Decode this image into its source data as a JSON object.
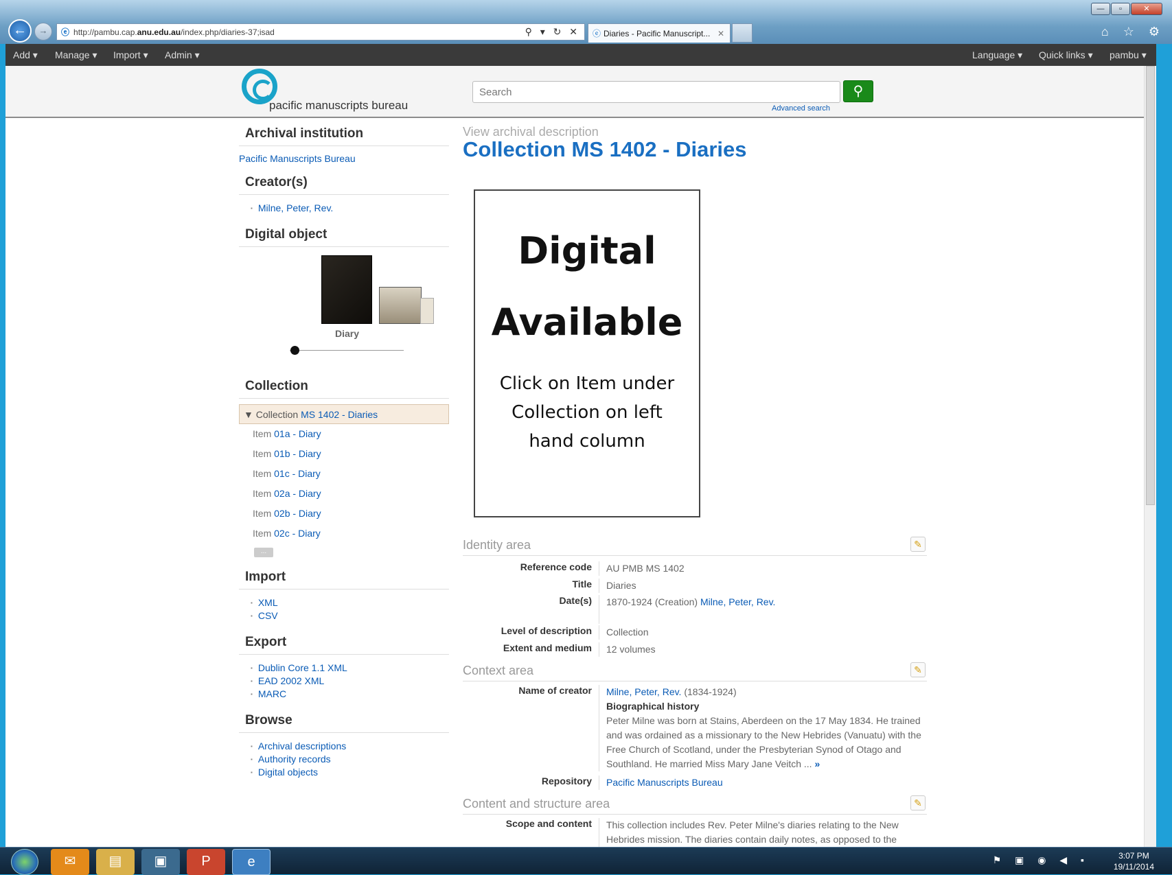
{
  "browser": {
    "url_prefix": "http://pambu.cap.",
    "url_domain": "anu.edu.au",
    "url_path": "/index.php/diaries-37;isad",
    "url_controls": "⚲ ▾ ↻ ✕",
    "tab_title": "Diaries - Pacific Manuscript...",
    "tab_close": "✕",
    "toolbar_icons": "⌂ ☆ ⚙"
  },
  "appbar": {
    "left": [
      "Add ▾",
      "Manage ▾",
      "Import ▾",
      "Admin ▾"
    ],
    "right": [
      "Language ▾",
      "Quick links ▾",
      "pambu ▾"
    ]
  },
  "header": {
    "logo_text": "pacific manuscripts bureau",
    "search_placeholder": "Search",
    "advanced_search": "Advanced search"
  },
  "sidebar": {
    "archival_institution": {
      "heading": "Archival institution",
      "link": "Pacific Manuscripts Bureau"
    },
    "creators": {
      "heading": "Creator(s)",
      "items": [
        "Milne, Peter, Rev."
      ]
    },
    "digital_object": {
      "heading": "Digital object",
      "caption": "Diary"
    },
    "collection": {
      "heading": "Collection",
      "root_prefix": "▼ Collection ",
      "root_link": "MS 1402 - Diaries",
      "items": [
        {
          "prefix": "Item ",
          "link": "01a - Diary"
        },
        {
          "prefix": "Item ",
          "link": "01b - Diary"
        },
        {
          "prefix": "Item ",
          "link": "01c - Diary"
        },
        {
          "prefix": "Item ",
          "link": "02a - Diary"
        },
        {
          "prefix": "Item ",
          "link": "02b - Diary"
        },
        {
          "prefix": "Item ",
          "link": "02c - Diary"
        }
      ],
      "more": "..."
    },
    "import": {
      "heading": "Import",
      "items": [
        "XML",
        "CSV"
      ]
    },
    "export": {
      "heading": "Export",
      "items": [
        "Dublin Core 1.1 XML",
        "EAD 2002 XML",
        "MARC"
      ]
    },
    "browse": {
      "heading": "Browse",
      "items": [
        "Archival descriptions",
        "Authority records",
        "Digital objects"
      ]
    }
  },
  "main": {
    "view_label": "View archival description",
    "title": "Collection MS 1402 - Diaries",
    "digital_placeholder": {
      "line1": "Digital",
      "line2": "Available",
      "line3": "Click on Item under",
      "line4": "Collection on left",
      "line5": "hand column"
    },
    "identity_area": {
      "heading": "Identity area",
      "reference_code_label": "Reference code",
      "reference_code": "AU PMB MS 1402",
      "title_label": "Title",
      "title": "Diaries",
      "dates_label": "Date(s)",
      "dates_text": "1870-1924 (Creation)",
      "dates_link": "Milne, Peter, Rev.",
      "level_label": "Level of description",
      "level": "Collection",
      "extent_label": "Extent and medium",
      "extent": "12 volumes"
    },
    "context_area": {
      "heading": "Context area",
      "creator_label": "Name of creator",
      "creator_link": "Milne, Peter, Rev.",
      "creator_dates": "(1834-1924)",
      "bio_heading": "Biographical history",
      "bio_text": "Peter Milne was born at Stains, Aberdeen on the 17 May 1834. He trained and was ordained as a missionary to the New Hebrides (Vanuatu) with the Free Church of Scotland, under the Presbyterian Synod of Otago and Southland. He married Miss Mary Jane Veitch ...",
      "bio_more": "»",
      "repository_label": "Repository",
      "repository_link": "Pacific Manuscripts Bureau"
    },
    "content_area": {
      "heading": "Content and structure area",
      "scope_label": "Scope and content",
      "scope_text": "This collection includes Rev. Peter Milne's diaries relating to the New Hebrides mission. The diaries contain daily notes, as opposed to the"
    }
  },
  "taskbar": {
    "time": "3:07 PM",
    "date": "19/11/2014"
  }
}
